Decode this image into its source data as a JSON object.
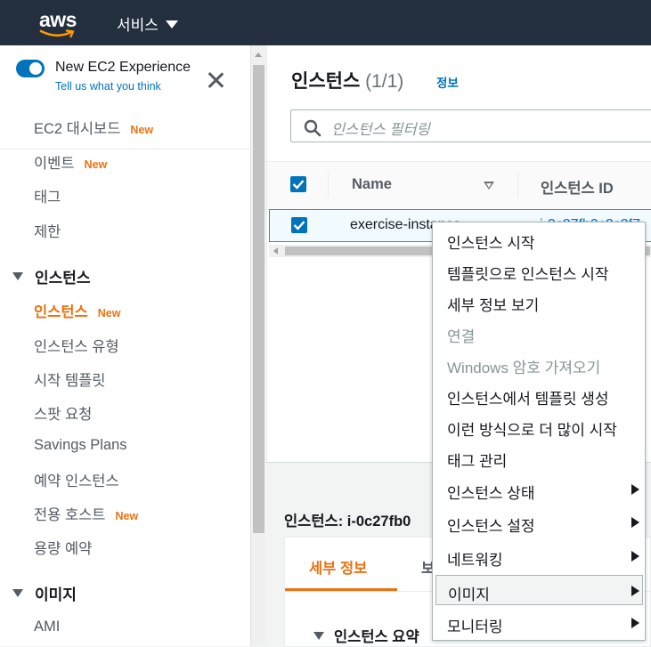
{
  "header": {
    "logo_text": "aws",
    "services_label": "서비스"
  },
  "sidebar": {
    "experience_title": "New EC2 Experience",
    "experience_link": "Tell us what you think",
    "new_badge": "New",
    "items": [
      {
        "label": "EC2 대시보드",
        "new": true
      },
      {
        "label": "이벤트",
        "new": true
      },
      {
        "label": "태그",
        "new": false
      },
      {
        "label": "제한",
        "new": false
      }
    ],
    "sections": [
      {
        "title": "인스턴스",
        "items": [
          {
            "label": "인스턴스",
            "new": true,
            "active": true
          },
          {
            "label": "인스턴스 유형",
            "new": false
          },
          {
            "label": "시작 템플릿",
            "new": false
          },
          {
            "label": "스팟 요청",
            "new": false
          },
          {
            "label": "Savings Plans",
            "new": false
          },
          {
            "label": "예약 인스턴스",
            "new": false
          },
          {
            "label": "전용 호스트",
            "new": true
          },
          {
            "label": "용량 예약",
            "new": false
          }
        ]
      },
      {
        "title": "이미지",
        "items": [
          {
            "label": "AMI",
            "new": false
          }
        ]
      }
    ]
  },
  "main": {
    "title": "인스턴스",
    "count": "(1/1)",
    "info_link": "정보",
    "search_placeholder": "인스턴스 필터링",
    "columns": [
      "Name",
      "인스턴스 ID"
    ],
    "rows": [
      {
        "name": "exercise-instance",
        "instance_id": "i-0c27fb0c2c3f7"
      }
    ],
    "detail_title": "인스턴스: i-0c27fb0",
    "detail_tabs": [
      "세부 정보",
      "보"
    ],
    "detail_section": "인스턴스 요약"
  },
  "context_menu": {
    "items": [
      {
        "label": "인스턴스 시작",
        "disabled": false,
        "submenu": false
      },
      {
        "label": "템플릿으로 인스턴스 시작",
        "disabled": false,
        "submenu": false
      },
      {
        "label": "세부 정보 보기",
        "disabled": false,
        "submenu": false
      },
      {
        "label": "연결",
        "disabled": true,
        "submenu": false
      },
      {
        "label": "Windows 암호 가져오기",
        "disabled": true,
        "submenu": false
      },
      {
        "label": "인스턴스에서 템플릿 생성",
        "disabled": false,
        "submenu": false
      },
      {
        "label": "이런 방식으로 더 많이 시작",
        "disabled": false,
        "submenu": false
      },
      {
        "label": "태그 관리",
        "disabled": false,
        "submenu": false
      },
      {
        "label": "인스턴스 상태",
        "disabled": false,
        "submenu": true
      },
      {
        "label": "인스턴스 설정",
        "disabled": false,
        "submenu": true
      },
      {
        "label": "네트워킹",
        "disabled": false,
        "submenu": true
      },
      {
        "label": "이미지",
        "disabled": false,
        "submenu": true,
        "hover": true
      },
      {
        "label": "모니터링",
        "disabled": false,
        "submenu": true
      }
    ]
  },
  "colors": {
    "topbar": "#232f3e",
    "accent_orange": "#ec7211",
    "link_blue": "#0073bb"
  }
}
